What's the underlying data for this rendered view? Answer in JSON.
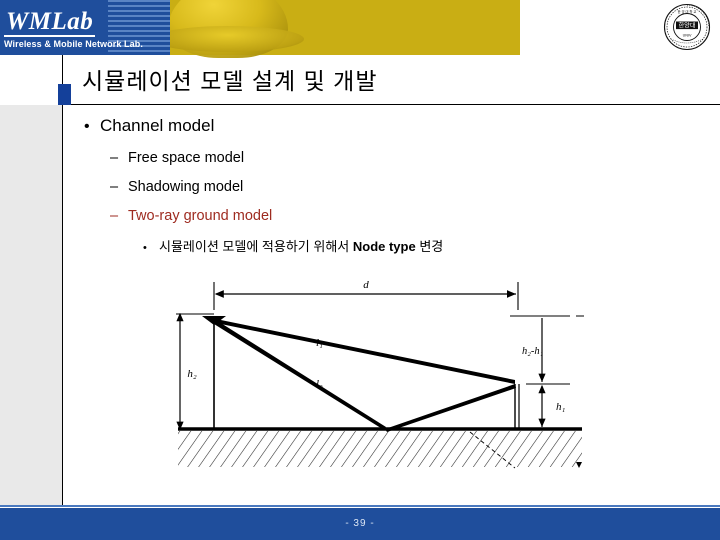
{
  "header": {
    "logo_main": "WMLab",
    "logo_sub": "Wireless & Mobile Network Lab.",
    "seal_name": "university-seal",
    "helmet_name": "hard-hat-graphic",
    "banner_blue": "#1F4E9C",
    "banner_gold": "#C9AE14"
  },
  "slide": {
    "title": "시뮬레이션 모델 설계 및 개발",
    "accent_color": "#14409A",
    "highlight_color": "#9E2B20"
  },
  "bullets": {
    "level1": {
      "marker": "•",
      "text": "Channel model"
    },
    "level2": [
      {
        "marker": "–",
        "text": "Free space model",
        "color": "#000000"
      },
      {
        "marker": "–",
        "text": "Shadowing model",
        "color": "#000000"
      },
      {
        "marker": "–",
        "text": "Two-ray ground model",
        "color": "#9E2B20"
      }
    ],
    "level3": {
      "marker": "•",
      "text_before": "시뮬레이션 모델에 적용하기 위해서 ",
      "text_bold": "Node type",
      "text_after": " 변경"
    }
  },
  "diagram": {
    "name": "two-ray-ground-reflection-diagram",
    "labels": {
      "distance": "d",
      "direct_ray": "l₁",
      "reflected_ray": "l₀",
      "tx_height": "h₂",
      "height_difference": "h₂-h₁",
      "rx_height": "h₁"
    }
  },
  "footer": {
    "page_number": "- 39 -",
    "bar_color": "#1F4E9C"
  }
}
